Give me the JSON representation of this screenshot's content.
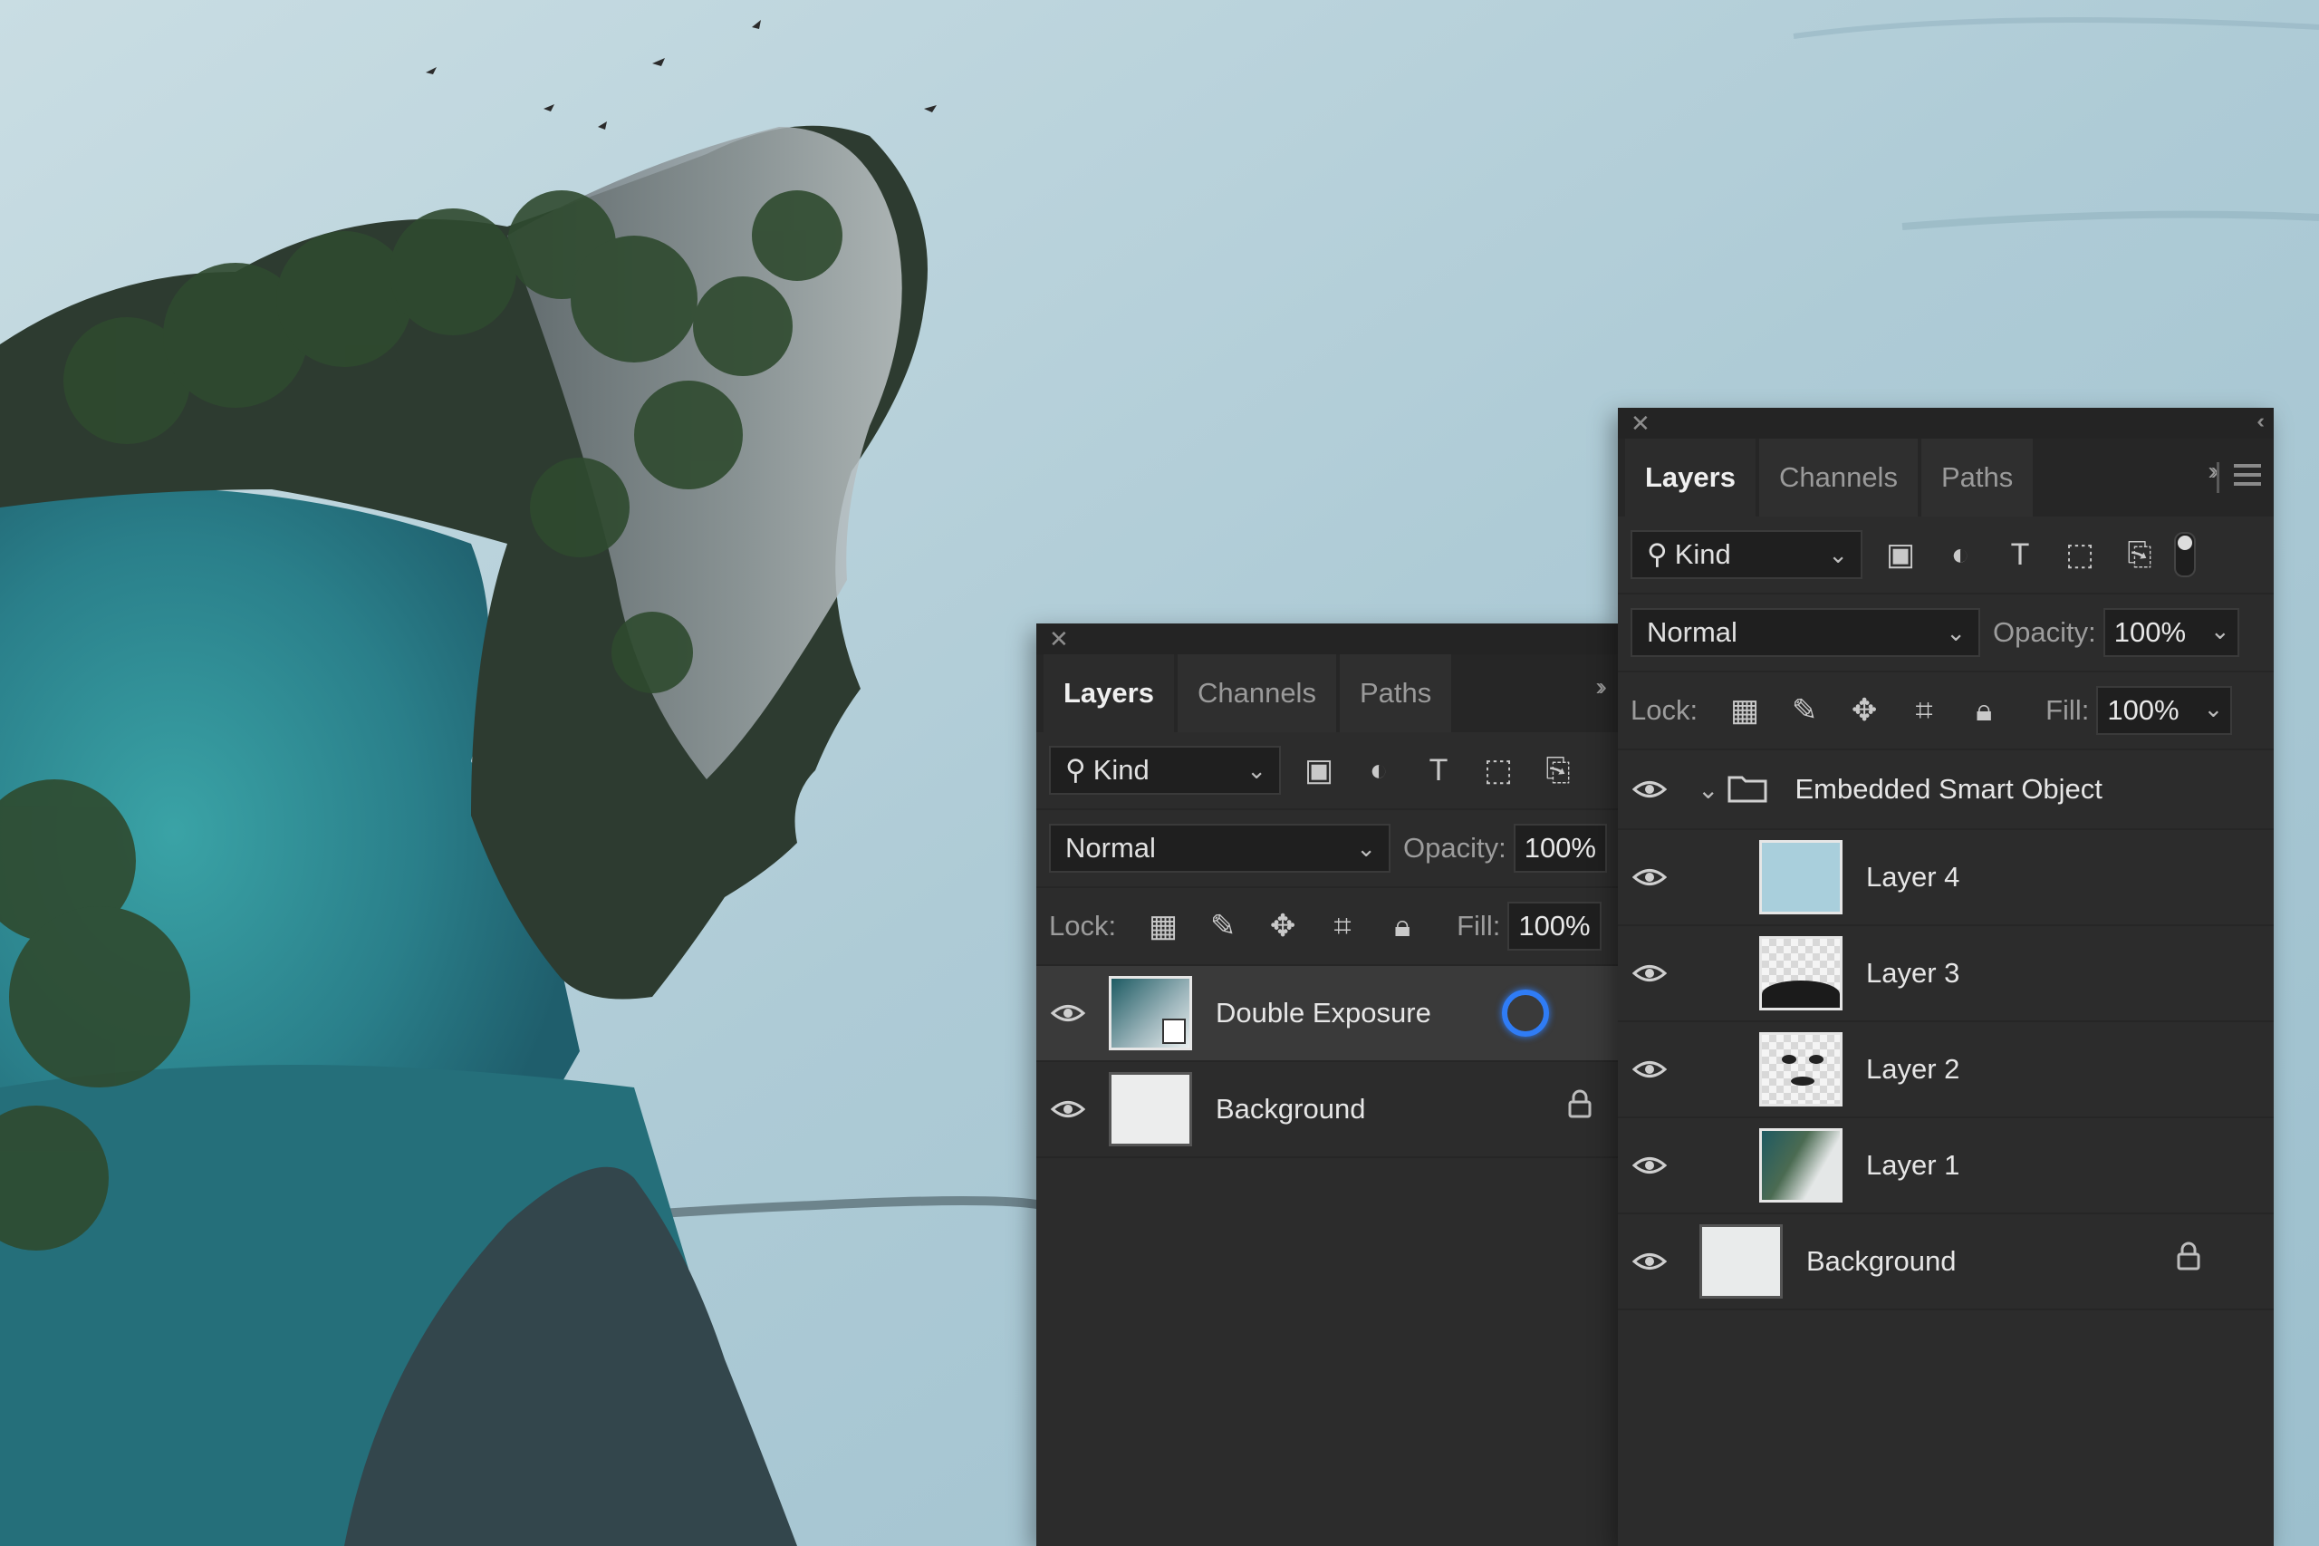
{
  "panel_small": {
    "tabs": [
      "Layers",
      "Channels",
      "Paths"
    ],
    "filter_kind": "Kind",
    "blend_mode": "Normal",
    "opacity_label": "Opacity:",
    "opacity_value": "100%",
    "lock_label": "Lock:",
    "fill_label": "Fill:",
    "fill_value": "100%",
    "layers": [
      "Double Exposure",
      "Background"
    ]
  },
  "panel_large": {
    "tabs": [
      "Layers",
      "Channels",
      "Paths"
    ],
    "filter_kind": "Kind",
    "blend_mode": "Normal",
    "opacity_label": "Opacity:",
    "opacity_value": "100%",
    "lock_label": "Lock:",
    "fill_label": "Fill:",
    "fill_value": "100%",
    "group_name": "Embedded Smart Object",
    "layers": [
      "Layer 4",
      "Layer 3",
      "Layer 2",
      "Layer 1",
      "Background"
    ]
  },
  "colors": {
    "panel_bg": "#2c2c2c",
    "sky": "#a9c8d4",
    "sea": "#2f8a92",
    "cursor_ring": "#2f7cf6"
  },
  "icons": [
    "close-icon",
    "collapse-icon",
    "search-icon",
    "image-filter-icon",
    "adjustment-filter-icon",
    "type-filter-icon",
    "shape-filter-icon",
    "smart-object-filter-icon",
    "lock-pixels-icon",
    "lock-paint-icon",
    "lock-move-icon",
    "lock-artboard-icon",
    "lock-all-icon",
    "eye-icon",
    "folder-icon",
    "lock-icon"
  ]
}
